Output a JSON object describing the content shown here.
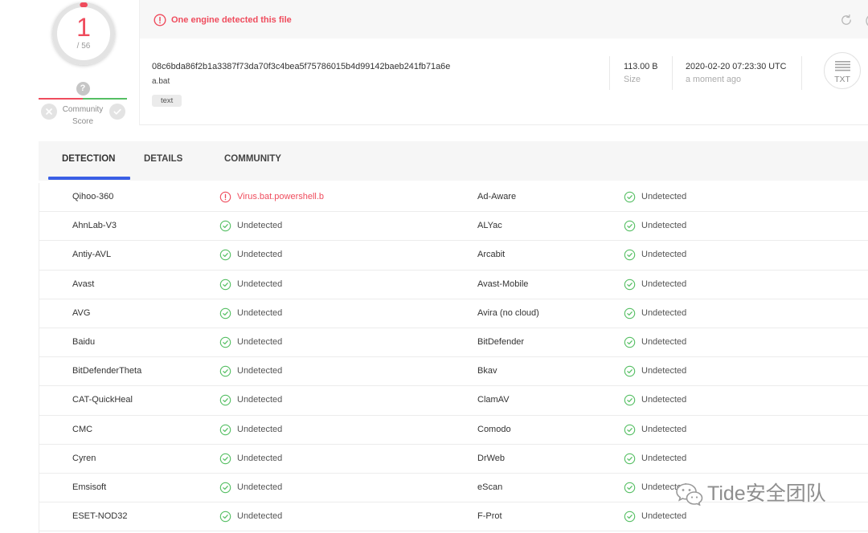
{
  "colors": {
    "malicious": "#ef4c5d",
    "clean": "#55bf63",
    "tab_active_underline": "#3a5fe5"
  },
  "score": {
    "detections": 1,
    "total": 56,
    "total_label": "/ 56"
  },
  "community_score": {
    "value": "?",
    "label": "Community Score",
    "malicious_fraction": 0.5,
    "vote_down_icon": "x-circle-icon",
    "vote_up_icon": "check-circle-icon"
  },
  "alert": {
    "icon": "alert-circle-icon",
    "text": "One engine detected this file"
  },
  "toolbar": {
    "reanalyze_icon": "refresh-icon"
  },
  "file": {
    "hash": "08c6bda86f2b1a3387f73da70f3c4bea5f75786015b4d99142baeb241fb71a6e",
    "name": "a.bat",
    "tags": [
      "text"
    ],
    "size": "113.00 B",
    "size_label": "Size",
    "last_analysis": "2020-02-20 07:23:30 UTC",
    "last_analysis_relative": "a moment ago",
    "type_icon": "txt-file-icon",
    "type_label": "TXT"
  },
  "tabs": [
    {
      "label": "DETECTION",
      "active": true
    },
    {
      "label": "DETAILS",
      "active": false
    },
    {
      "label": "COMMUNITY",
      "active": false
    }
  ],
  "detections": [
    {
      "left": {
        "engine": "Qihoo-360",
        "result": "Virus.bat.powershell.b",
        "icon": "alert-circle-icon"
      },
      "right": {
        "engine": "Ad-Aware",
        "result": "Undetected",
        "icon": "check-circle-icon"
      }
    },
    {
      "left": {
        "engine": "AhnLab-V3",
        "result": "Undetected",
        "icon": "check-circle-icon"
      },
      "right": {
        "engine": "ALYac",
        "result": "Undetected",
        "icon": "check-circle-icon"
      }
    },
    {
      "left": {
        "engine": "Antiy-AVL",
        "result": "Undetected",
        "icon": "check-circle-icon"
      },
      "right": {
        "engine": "Arcabit",
        "result": "Undetected",
        "icon": "check-circle-icon"
      }
    },
    {
      "left": {
        "engine": "Avast",
        "result": "Undetected",
        "icon": "check-circle-icon"
      },
      "right": {
        "engine": "Avast-Mobile",
        "result": "Undetected",
        "icon": "check-circle-icon"
      }
    },
    {
      "left": {
        "engine": "AVG",
        "result": "Undetected",
        "icon": "check-circle-icon"
      },
      "right": {
        "engine": "Avira (no cloud)",
        "result": "Undetected",
        "icon": "check-circle-icon"
      }
    },
    {
      "left": {
        "engine": "Baidu",
        "result": "Undetected",
        "icon": "check-circle-icon"
      },
      "right": {
        "engine": "BitDefender",
        "result": "Undetected",
        "icon": "check-circle-icon"
      }
    },
    {
      "left": {
        "engine": "BitDefenderTheta",
        "result": "Undetected",
        "icon": "check-circle-icon"
      },
      "right": {
        "engine": "Bkav",
        "result": "Undetected",
        "icon": "check-circle-icon"
      }
    },
    {
      "left": {
        "engine": "CAT-QuickHeal",
        "result": "Undetected",
        "icon": "check-circle-icon"
      },
      "right": {
        "engine": "ClamAV",
        "result": "Undetected",
        "icon": "check-circle-icon"
      }
    },
    {
      "left": {
        "engine": "CMC",
        "result": "Undetected",
        "icon": "check-circle-icon"
      },
      "right": {
        "engine": "Comodo",
        "result": "Undetected",
        "icon": "check-circle-icon"
      }
    },
    {
      "left": {
        "engine": "Cyren",
        "result": "Undetected",
        "icon": "check-circle-icon"
      },
      "right": {
        "engine": "DrWeb",
        "result": "Undetected",
        "icon": "check-circle-icon"
      }
    },
    {
      "left": {
        "engine": "Emsisoft",
        "result": "Undetected",
        "icon": "check-circle-icon"
      },
      "right": {
        "engine": "eScan",
        "result": "Undetected",
        "icon": "check-circle-icon"
      }
    },
    {
      "left": {
        "engine": "ESET-NOD32",
        "result": "Undetected",
        "icon": "check-circle-icon"
      },
      "right": {
        "engine": "F-Prot",
        "result": "Undetected",
        "icon": "check-circle-icon"
      }
    }
  ],
  "watermark": {
    "icon": "wechat-icon",
    "text": "Tide安全团队"
  }
}
